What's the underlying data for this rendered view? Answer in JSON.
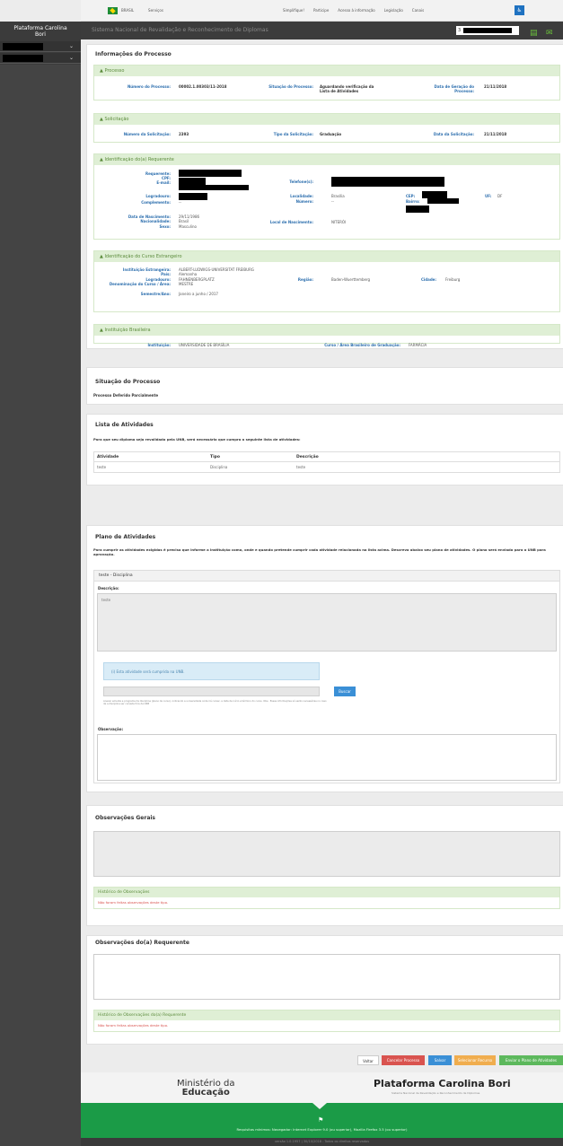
{
  "gov_bar": {
    "brasil": "BRASIL",
    "servicos": "Serviços",
    "links": [
      "Simplifique!",
      "Participe",
      "Acesso à informação",
      "Legislação",
      "Canais"
    ]
  },
  "sidebar": {
    "brand_line1": "Plataforma Carolina",
    "brand_line2": "Bori"
  },
  "header": {
    "system_title": "Sistema Nacional de Revalidação e Reconhecimento de Diplomas",
    "user_initial": "3"
  },
  "info": {
    "title": "Informações do Processo",
    "processo": {
      "label": "Processo",
      "numero_label": "Número do Processo:",
      "numero": "00002.1.00303/11-2018",
      "situacao_label": "Situação do Processo:",
      "situacao": "Aguardando verificação da Lista de Atividades",
      "data_label": "Data de Geração do Processo:",
      "data": "21/11/2018"
    },
    "solicitacao": {
      "label": "Solicitação",
      "numero_label": "Número da Solicitação:",
      "numero": "2393",
      "tipo_label": "Tipo da Solicitação:",
      "tipo": "Graduação",
      "data_label": "Data da Solicitação:",
      "data": "21/11/2018"
    },
    "requerente": {
      "label": "Identificação do(a) Requerente",
      "req_label": "Requerente:",
      "cpf_label": "CPF:",
      "email_label": "E-mail:",
      "logradouro_label": "Logradouro:",
      "complemento_label": "Complemento:",
      "complemento": "--",
      "telefone_label": "Telefone(s):",
      "localidade_label": "Localidade:",
      "localidade": "Brasília",
      "numero_label": "Número:",
      "numero": "--",
      "cep_label": "CEP:",
      "bairro_label": "Bairro:",
      "uf_label": "UF:",
      "uf": "DF",
      "nascimento_label": "Data de Nascimento:",
      "nascimento": "29/11/1986",
      "nacionalidade_label": "Nacionalidade:",
      "nacionalidade": "Brasil",
      "sexo_label": "Sexo:",
      "sexo": "Masculino",
      "local_nasc_label": "Local de Nascimento:",
      "local_nasc": "NITERÓI"
    },
    "curso": {
      "label": "Identificação do Curso Estrangeiro",
      "inst_label": "Instituição Estrangeira:",
      "inst": "ALBERT-LUDWIGS-UNIVERSITAT FREIBURG",
      "pais_label": "País:",
      "pais": "Alemanha",
      "logradouro_label": "Logradouro:",
      "logradouro": "FAHNENBERGPLATZ",
      "denom_label": "Denominação do Curso / Área:",
      "denom": "MESTRE",
      "semestre_label": "Semestre/Ano:",
      "semestre": "Janeiro a junho / 2017",
      "regiao_label": "Região:",
      "regiao": "Baden-Wuerttemberg",
      "cidade_label": "Cidade:",
      "cidade": "Freiburg"
    },
    "instituicao": {
      "label": "Instituição Brasileira",
      "inst_label": "Instituição:",
      "inst": "UNIVERSIDADE DE BRASÍLIA",
      "curso_label": "Curso / Área Brasileiro de Graduação:",
      "curso": "FARMÁCIA"
    }
  },
  "situacao": {
    "title": "Situação do Processo",
    "text": "Processo Deferido Parcialmente"
  },
  "atividades": {
    "title": "Lista de Atividades",
    "intro": "Para que seu diploma seja revalidado pela UNB, será necessário que cumpra a seguinte lista de atividades:",
    "headers": [
      "Atividade",
      "Tipo",
      "Descrição"
    ],
    "rows": [
      [
        "teste",
        "Disciplina",
        "teste"
      ]
    ]
  },
  "plano": {
    "title": "Plano de Atividades",
    "intro": "Para cumprir as atividades exigidas é preciso que informe a instituição como, onde e quando pretende cumprir cada atividade relacionada na lista acima. Descreva abaixo seu plano de atividades. O plano será enviado para o UNB para aprovação.",
    "item_title": "teste - Disciplina",
    "descricao_label": "Descrição:",
    "descricao": "teste",
    "info": "(i)  Esta atividade será cumprida na UNB.",
    "buscar": "Buscar",
    "hint": "Anexar ementa e programa da disciplina (plano de curso), indicando a universidade onde irá cursar, a data de início e término do curso. Obs.: Essas informações só serão necessárias no caso de a disciplina ser cursada fora da UNB",
    "obs_label": "Observação:"
  },
  "obs_gerais": {
    "title": "Observações Gerais",
    "hist_title": "Histórico de Observações",
    "hist_empty": "Não foram feitas observações deste tipo."
  },
  "obs_req": {
    "title": "Observações do(a) Requerente",
    "hist_title": "Histórico de Observações do(a) Requerente",
    "hist_empty": "Não foram feitas observações deste tipo."
  },
  "actions": {
    "voltar": "Voltar",
    "cancelar": "Cancelar Processo",
    "salvar": "Salvar",
    "selecionar": "Selecionar Recurso",
    "enviar": "Enviar o Plano de Atividades"
  },
  "footer": {
    "ministerio": "Ministério da",
    "educacao": "Educação",
    "plataforma": "Plataforma Carolina Bori",
    "sub": "Sistema Nacional de Revalidação e Reconhecimento de Diplomas",
    "requisitos": "Requisitos mínimos: Navegador: Internet Explorer 9.0 (ou superior), Mozilla Firefox 3.5 (ou superior)",
    "versao": "versão 1.0.1957  |  30/10/2018  -  Todos os direitos reservados"
  },
  "colors": {
    "green": "#1b9b47",
    "panel_green": "#dfefd5",
    "red_btn": "#d9534f",
    "blue_btn": "#3a8fd6",
    "orange_btn": "#f0ad4e",
    "green_btn": "#5cb85c"
  }
}
